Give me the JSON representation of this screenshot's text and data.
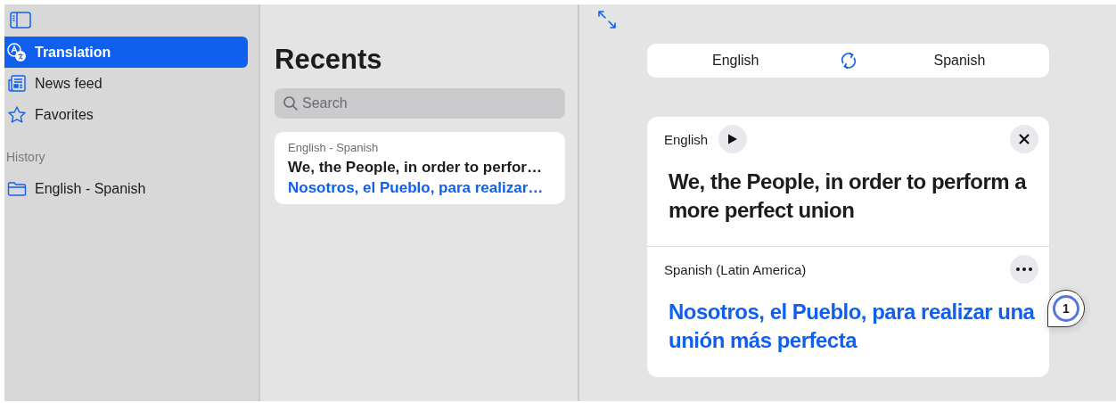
{
  "sidebar": {
    "items": [
      {
        "kind": "translate",
        "label": "Translation",
        "selected": true
      },
      {
        "kind": "news",
        "label": "News feed",
        "selected": false
      },
      {
        "kind": "star",
        "label": "Favorites",
        "selected": false
      }
    ],
    "history_heading": "History",
    "history": [
      {
        "label": "English - Spanish",
        "selected": false
      }
    ]
  },
  "recents": {
    "title": "Recents",
    "search": {
      "placeholder": "Search"
    },
    "items": [
      {
        "pair": "English - Spanish",
        "source": "We, the People, in order to perfor…",
        "target": "Nosotros, el Pueblo, para realizar…"
      }
    ]
  },
  "translator": {
    "from_language": "English",
    "to_language": "Spanish",
    "source": {
      "language": "English",
      "text": "We, the People, in order to perform a more perfect union"
    },
    "target": {
      "language": "Spanish (Latin America)",
      "text": "Nosotros, el Pueblo, para realizar una unión más perfecta"
    },
    "callout": "1"
  }
}
